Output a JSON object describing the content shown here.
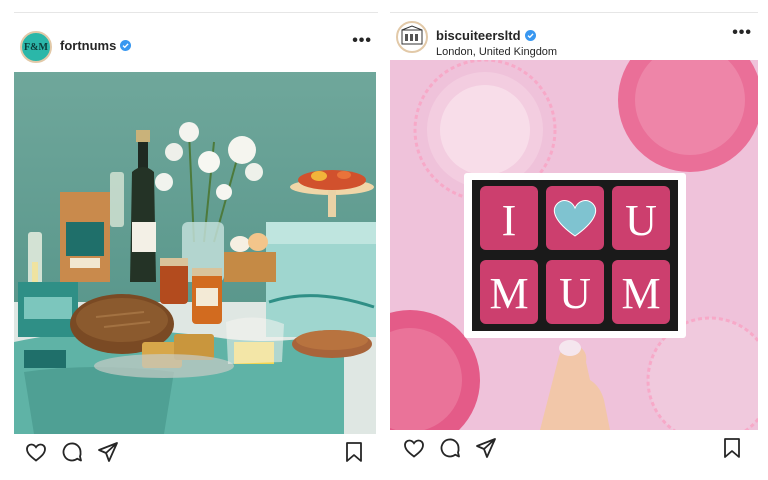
{
  "posts": [
    {
      "username": "fortnums",
      "avatar_text": "F&M",
      "verified": true,
      "more_label": "•••",
      "image_alt": "Fortnum & Mason hamper spread with champagne, bread, flowers and preserves"
    },
    {
      "username": "biscuiteersltd",
      "location": "London, United Kingdom",
      "verified": true,
      "more_label": "•••",
      "image_text": {
        "row1": [
          "I",
          "",
          "U"
        ],
        "row2": [
          "M",
          "U",
          "M"
        ]
      }
    }
  ],
  "colors": {
    "verified": "#3897f0",
    "icon": "#262626",
    "teal": "#2f8f86",
    "pink": "#e9c6d9"
  },
  "icons": [
    "heart-icon",
    "comment-icon",
    "share-icon",
    "bookmark-icon",
    "more-icon",
    "verified-icon"
  ]
}
